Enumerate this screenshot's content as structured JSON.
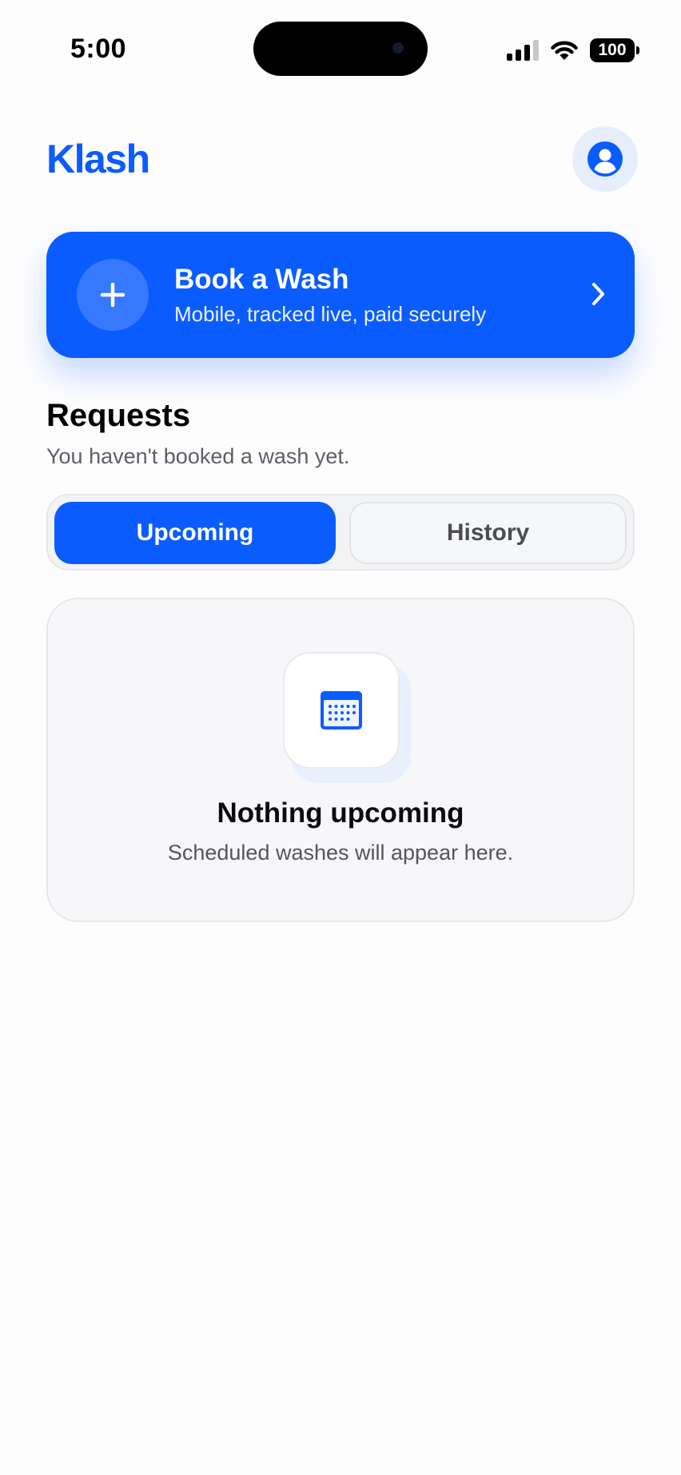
{
  "status_bar": {
    "time": "5:00",
    "battery": "100",
    "icons": [
      "signal-icon",
      "wifi-icon",
      "battery-icon"
    ]
  },
  "header": {
    "logo": "Klash",
    "profile_icon": "person-circle-icon"
  },
  "book_card": {
    "title": "Book a Wash",
    "subtitle": "Mobile, tracked live, paid securely",
    "icon": "plus-icon",
    "chevron": "chevron-right-icon"
  },
  "requests": {
    "title": "Requests",
    "subtitle": "You haven't booked a wash yet.",
    "tabs": [
      {
        "label": "Upcoming",
        "selected": true
      },
      {
        "label": "History",
        "selected": false
      }
    ]
  },
  "empty_state": {
    "icon": "calendar-icon",
    "title": "Nothing upcoming",
    "subtitle": "Scheduled washes will appear here."
  },
  "colors": {
    "accent": "#0a5cff",
    "background": "#fdfdfe",
    "muted_text": "#5e5e67"
  }
}
